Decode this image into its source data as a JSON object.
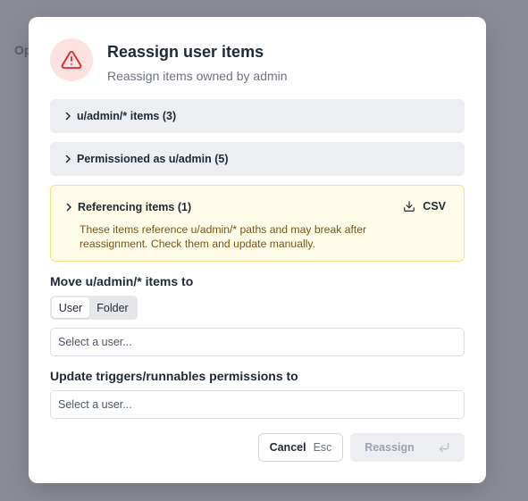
{
  "background": {
    "partial_text": "Op"
  },
  "dialog": {
    "title": "Reassign user items",
    "subtitle": "Reassign items owned by admin",
    "warning_icon": "warning-triangle-icon",
    "accent_color": "#dc2626"
  },
  "sections": [
    {
      "label": "u/admin/* items (3)"
    },
    {
      "label": "Permissioned as u/admin (5)"
    }
  ],
  "referencing": {
    "label": "Referencing items (1)",
    "csv_label": "CSV",
    "description": "These items reference u/admin/* paths and may break after reassignment. Check them and update manually."
  },
  "move": {
    "label": "Move u/admin/* items to",
    "toggle": [
      "User",
      "Folder"
    ],
    "selected": "User",
    "placeholder": "Select a user..."
  },
  "triggers": {
    "label": "Update triggers/runnables permissions to",
    "placeholder": "Select a user..."
  },
  "footer": {
    "cancel_label": "Cancel",
    "cancel_shortcut": "Esc",
    "reassign_label": "Reassign"
  }
}
